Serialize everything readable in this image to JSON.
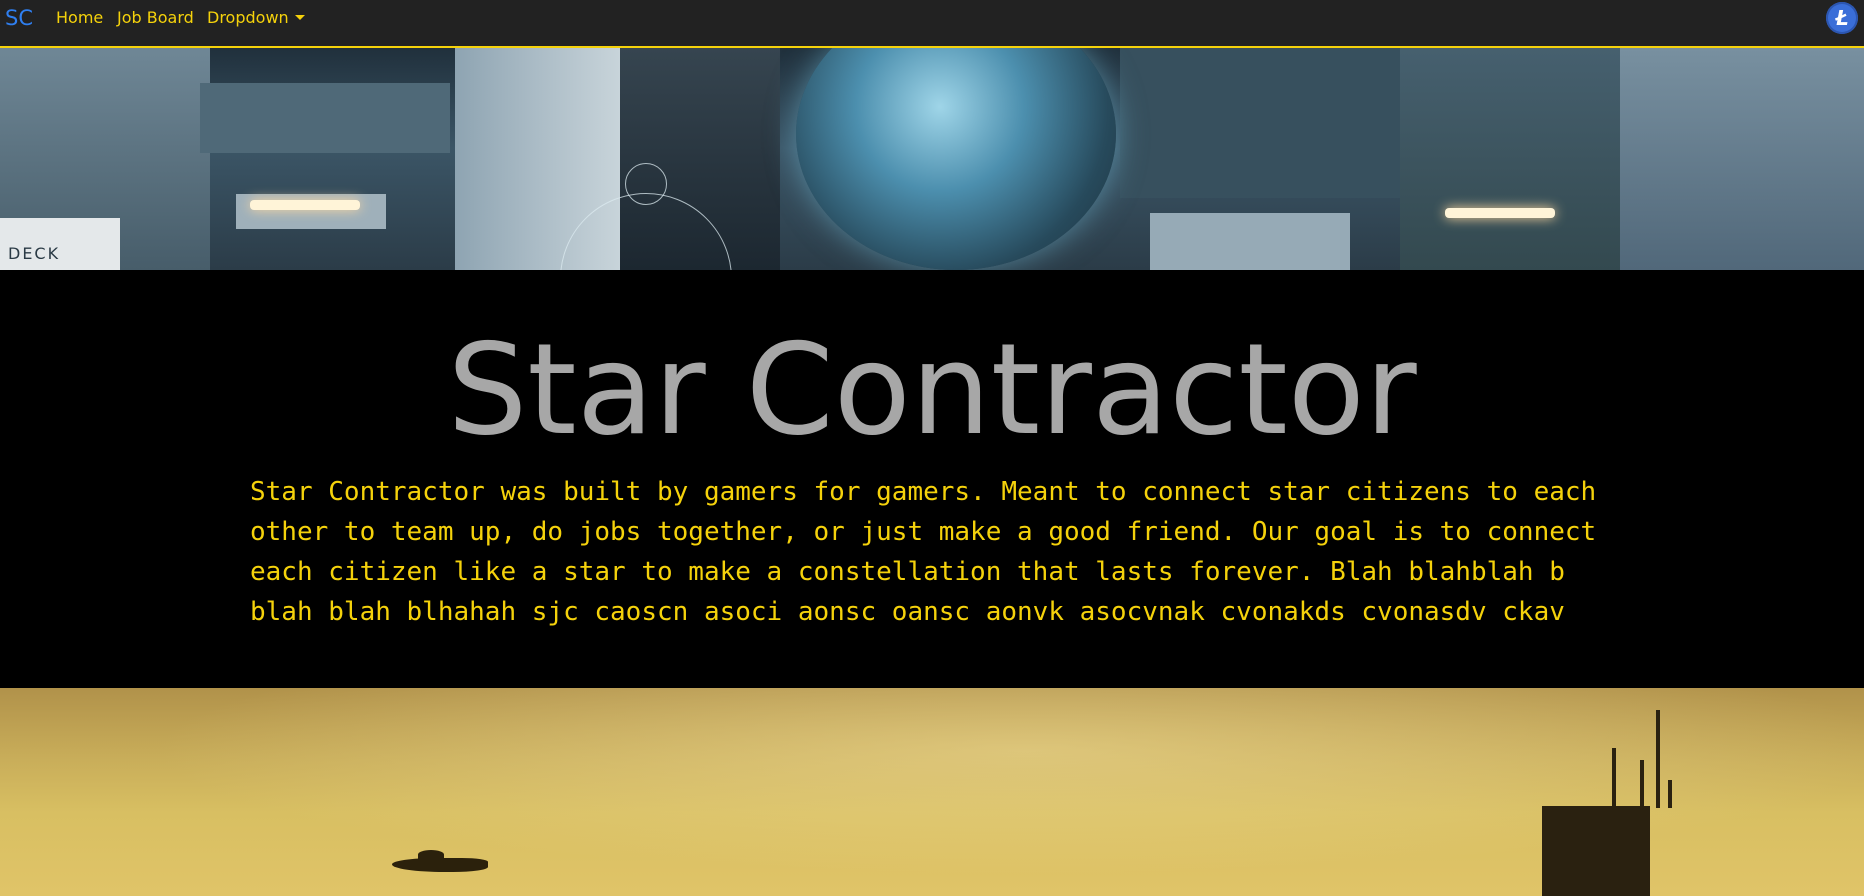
{
  "navbar": {
    "brand": "SC",
    "links": [
      "Home",
      "Job Board",
      "Dropdown"
    ],
    "accent_color": "#f5d20b",
    "brand_color": "#2f7ff0",
    "account_icon": "litecoin-icon"
  },
  "hero_top": {
    "image": "sci-fi-interior-banner",
    "deck_label": "DECK"
  },
  "main": {
    "title": "Star Contractor",
    "description": "Star Contractor was built by gamers for gamers. Meant to connect star citizens to each other to team up, do jobs together, or just make a good friend. Our goal is to connect each citizen like a star to make a constellation that lasts forever. Blah blahblah b blah blah blhahah sjc caoscn asoci aonsc oansc aonvk asocvnak cvonakds cvonasdv ckav"
  },
  "hero_bottom": {
    "image": "desert-sky-ship-banner"
  }
}
